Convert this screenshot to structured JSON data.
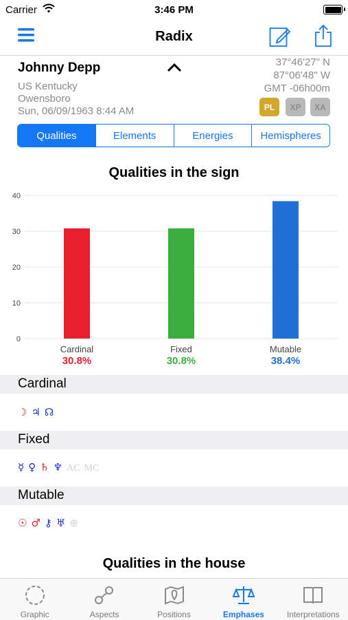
{
  "status_bar": {
    "carrier": "Carrier",
    "time": "3:46 PM"
  },
  "nav": {
    "title": "Radix"
  },
  "person": {
    "name": "Johnny Depp",
    "region": "US Kentucky",
    "city": "Owensboro",
    "datetime": "Sun, 06/09/1963 8:44 AM",
    "latitude": "37°46'27\" N",
    "longitude": "87°06'48\" W",
    "timezone": "GMT -06h00m"
  },
  "badges": [
    {
      "label": "PL",
      "color": "#d4a72c",
      "active": true
    },
    {
      "label": "XP",
      "color": "#b9b9b9",
      "active": false
    },
    {
      "label": "XA",
      "color": "#b9b9b9",
      "active": false
    }
  ],
  "segments": [
    "Qualities",
    "Elements",
    "Energies",
    "Hemispheres"
  ],
  "colors": {
    "accent": "#1478f4",
    "cardinal": "#e8202e",
    "fixed": "#3aad3e",
    "mutable": "#1e6fd6"
  },
  "chart_data": {
    "type": "bar",
    "title": "Qualities in the sign",
    "categories": [
      "Cardinal",
      "Fixed",
      "Mutable"
    ],
    "values": [
      30.8,
      30.8,
      38.4
    ],
    "value_labels": [
      "30.8%",
      "30.8%",
      "38.4%"
    ],
    "colors": [
      "#e8202e",
      "#3aad3e",
      "#1e6fd6"
    ],
    "ylim": [
      0,
      40
    ],
    "yticks": [
      "0",
      "10",
      "20",
      "30",
      "40"
    ],
    "grid": true
  },
  "sections": [
    {
      "title": "Cardinal",
      "glyphs": [
        {
          "symbol": "☽",
          "color": "#e8202e"
        },
        {
          "symbol": "♃",
          "color": "#1a2fd0"
        },
        {
          "symbol": "☊",
          "color": "#1a2fd0"
        }
      ]
    },
    {
      "title": "Fixed",
      "glyphs": [
        {
          "symbol": "☿",
          "color": "#1a2fd0"
        },
        {
          "symbol": "♀",
          "color": "#1a2fd0"
        },
        {
          "symbol": "♄",
          "color": "#e8202e"
        },
        {
          "symbol": "♆",
          "color": "#1a2fd0"
        },
        {
          "symbol": "AC",
          "color": "#d0d0d0"
        },
        {
          "symbol": "MC",
          "color": "#d0d0d0"
        }
      ]
    },
    {
      "title": "Mutable",
      "glyphs": [
        {
          "symbol": "☉",
          "color": "#e8202e"
        },
        {
          "symbol": "♂",
          "color": "#e8202e"
        },
        {
          "symbol": "⚷",
          "color": "#1a2fd0"
        },
        {
          "symbol": "♅",
          "color": "#1a2fd0"
        },
        {
          "symbol": "⊕",
          "color": "#d0d0d0"
        }
      ]
    }
  ],
  "second_heading": "Qualities in the house",
  "tabs": [
    {
      "label": "Graphic",
      "icon": "circle-dashed-icon",
      "active": false
    },
    {
      "label": "Aspects",
      "icon": "aspects-link-icon",
      "active": false
    },
    {
      "label": "Positions",
      "icon": "map-pin-icon",
      "active": false
    },
    {
      "label": "Emphases",
      "icon": "scales-icon",
      "active": true
    },
    {
      "label": "Interpretations",
      "icon": "book-icon",
      "active": false
    }
  ]
}
